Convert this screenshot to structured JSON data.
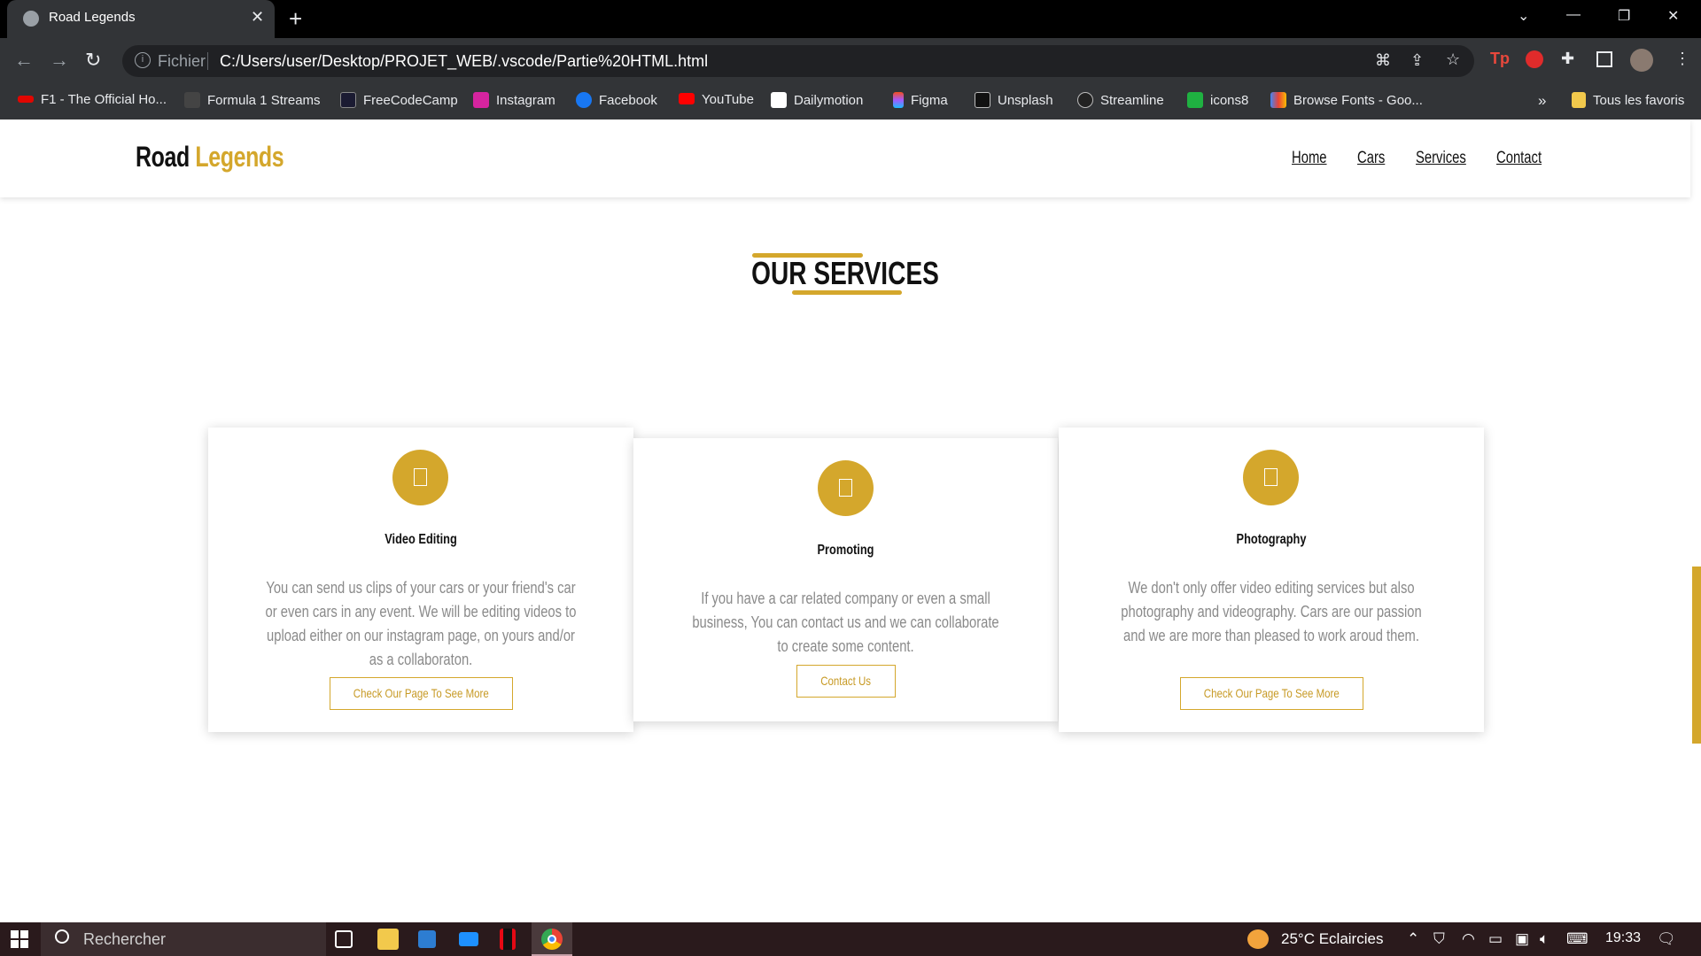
{
  "browser": {
    "tab_title": "Road Legends",
    "tab_close": "✕",
    "new_tab": "+",
    "url_scheme": "Fichier",
    "url": "C:/Users/user/Desktop/PROJET_WEB/.vscode/Partie%20HTML.html",
    "bookmarks": [
      {
        "label": "F1 - The Official Ho...",
        "color": "#e10600"
      },
      {
        "label": "Formula 1 Streams",
        "color": "#444444"
      },
      {
        "label": "FreeCodeCamp",
        "color": "#1b1b32"
      },
      {
        "label": "Instagram",
        "color": "#d6249f"
      },
      {
        "label": "Facebook",
        "color": "#1877f2"
      },
      {
        "label": "YouTube",
        "color": "#ff0000"
      },
      {
        "label": "Dailymotion",
        "color": "#ffffff"
      },
      {
        "label": "Figma",
        "color": "#a259ff"
      },
      {
        "label": "Unsplash",
        "color": "#111111"
      },
      {
        "label": "Streamline",
        "color": "#222222"
      },
      {
        "label": "icons8",
        "color": "#1fb141"
      },
      {
        "label": "Browse Fonts - Goo...",
        "color": "#4285f4"
      }
    ],
    "bookmarks_more": "»",
    "all_bookmarks": "Tous les favoris"
  },
  "site": {
    "logo_road": "Road",
    "logo_legends": "Legends",
    "nav": [
      "Home",
      "Cars",
      "Services",
      "Contact"
    ],
    "section_title": "OUR SERVICES",
    "icon_glyph": "",
    "cards": [
      {
        "title": "Video Editing",
        "text": "You can send us clips of your cars or your friend's car or even cars in any event. We will be editing videos to upload either on our instagram page, on yours and/or as a collaboraton.",
        "button": "Check Our Page To See More"
      },
      {
        "title": "Promoting",
        "text": "If you have a car related company or even a small business, You can contact us and we can collaborate to create some content.",
        "button": "Contact Us"
      },
      {
        "title": "Photography",
        "text": "We don't only offer video editing services but also photography and videography. Cars are our passion and we are more than pleased to work aroud them.",
        "button": "Check Our Page To See More"
      }
    ]
  },
  "taskbar": {
    "search_placeholder": "Rechercher",
    "weather": "25°C  Eclaircies",
    "time": "19:33"
  },
  "colors": {
    "accent": "#d4a72c",
    "chrome_bg": "#323437",
    "taskbar_bg": "#2a1a1c"
  }
}
